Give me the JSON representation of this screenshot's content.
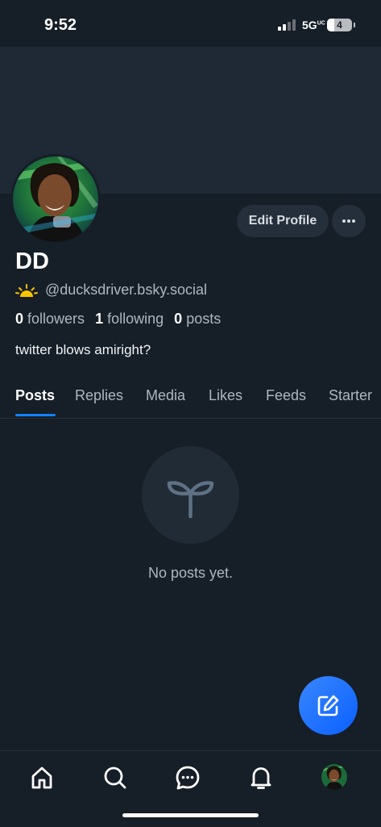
{
  "status_bar": {
    "time": "9:52",
    "network": "5G",
    "network_sup": "UC",
    "battery": "4"
  },
  "profile": {
    "display_name": "DD",
    "handle": "@ducksdriver.bsky.social",
    "bio": "twitter blows amiright?",
    "stats": {
      "followers_count": "0",
      "followers_label": "followers",
      "following_count": "1",
      "following_label": "following",
      "posts_count": "0",
      "posts_label": "posts"
    }
  },
  "actions": {
    "edit_profile": "Edit Profile"
  },
  "tabs": [
    {
      "label": "Posts",
      "active": true
    },
    {
      "label": "Replies"
    },
    {
      "label": "Media"
    },
    {
      "label": "Likes"
    },
    {
      "label": "Feeds"
    },
    {
      "label": "Starter"
    }
  ],
  "empty_state": {
    "message": "No posts yet.",
    "icon": "sprout-icon"
  },
  "fab": {
    "icon": "compose-icon"
  },
  "bottom_nav": [
    {
      "icon": "home-icon"
    },
    {
      "icon": "search-icon"
    },
    {
      "icon": "chat-icon"
    },
    {
      "icon": "bell-icon"
    },
    {
      "icon": "profile-avatar"
    }
  ],
  "colors": {
    "background": "#161e27",
    "banner": "#1e2935",
    "accent": "#1083fe",
    "muted_text": "#aeb6bf"
  }
}
